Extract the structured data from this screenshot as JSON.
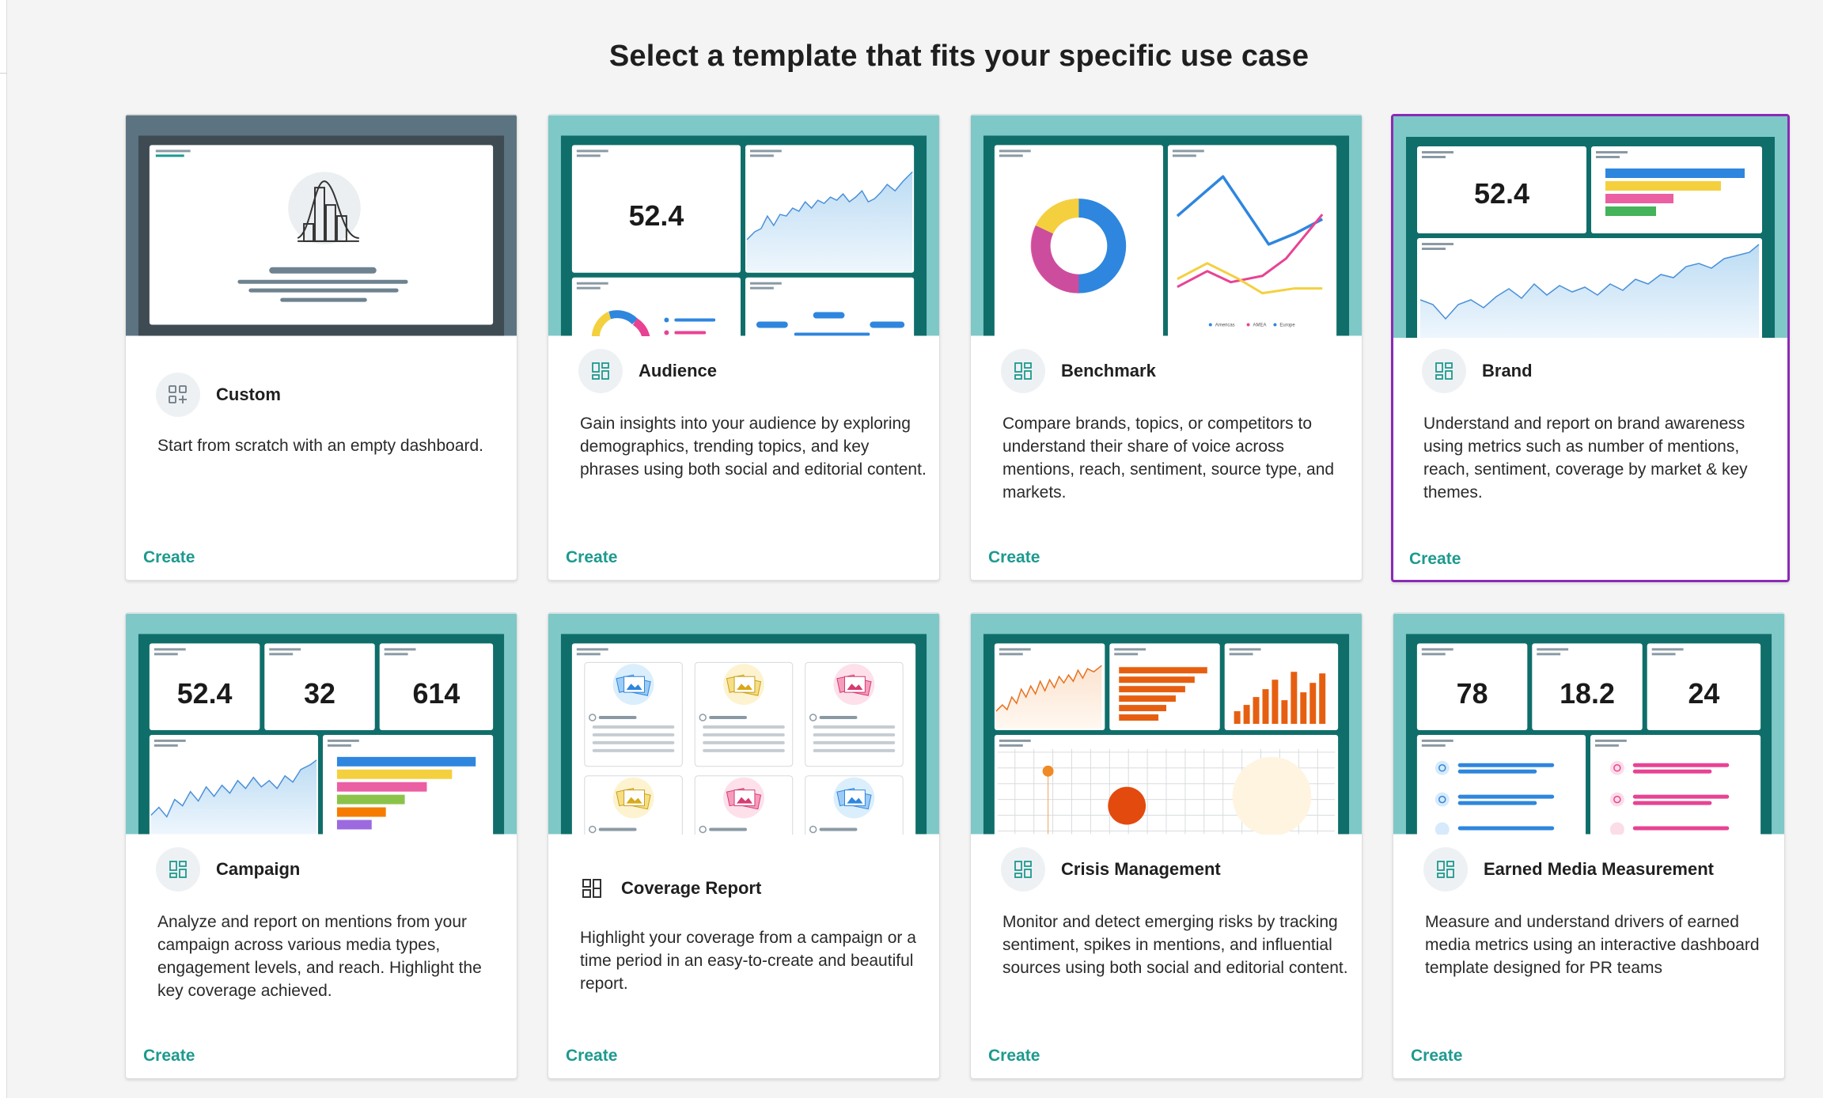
{
  "page": {
    "title": "Select a template that fits your specific use case"
  },
  "colors": {
    "accent": "#1d9a8f",
    "selected_border": "#8a2bb5",
    "thumb_teal": "#7fc8c8",
    "thumb_dark_teal": "#0f6e6a",
    "thumb_slate": "#5c7482"
  },
  "templates": [
    {
      "id": "custom",
      "title": "Custom",
      "description": "Start from scratch with an empty dashboard.",
      "action": "Create",
      "icon": "add-widget-icon"
    },
    {
      "id": "audience",
      "title": "Audience",
      "description": "Gain insights into your audience by exploring demographics, trending topics, and key phrases using both social and editorial content.",
      "action": "Create",
      "icon": "dashboard-icon",
      "preview_metric": "52.4"
    },
    {
      "id": "benchmark",
      "title": "Benchmark",
      "description": "Compare brands, topics, or competitors to understand their share of voice across mentions, reach, sentiment, source type, and markets.",
      "action": "Create",
      "icon": "dashboard-icon",
      "preview_legend": [
        "Americas",
        "AMEA",
        "Europe"
      ]
    },
    {
      "id": "brand",
      "title": "Brand",
      "description": "Understand and report on brand awareness using metrics such as number of mentions, reach, sentiment, coverage by market & key themes.",
      "action": "Create",
      "icon": "dashboard-icon",
      "selected": true,
      "preview_metric": "52.4"
    },
    {
      "id": "campaign",
      "title": "Campaign",
      "description": "Analyze and report on mentions from your campaign across various media types, engagement levels, and reach. Highlight the key coverage achieved.",
      "action": "Create",
      "icon": "dashboard-icon",
      "preview_metrics": [
        "52.4",
        "32",
        "614"
      ]
    },
    {
      "id": "coverage-report",
      "title": "Coverage Report",
      "description": "Highlight your coverage from a campaign or a time period in an easy-to-create and beautiful report.",
      "action": "Create",
      "icon": "report-icon"
    },
    {
      "id": "crisis-management",
      "title": "Crisis Management",
      "description": "Monitor and detect emerging risks by tracking sentiment, spikes in mentions, and influential sources using both social and editorial content.",
      "action": "Create",
      "icon": "dashboard-icon"
    },
    {
      "id": "earned-media-measurement",
      "title": "Earned Media Measurement",
      "description": "Measure and understand drivers of earned media metrics using an interactive dashboard template designed for PR teams",
      "action": "Create",
      "icon": "dashboard-icon",
      "preview_metrics": [
        "78",
        "18.2",
        "24"
      ]
    }
  ]
}
